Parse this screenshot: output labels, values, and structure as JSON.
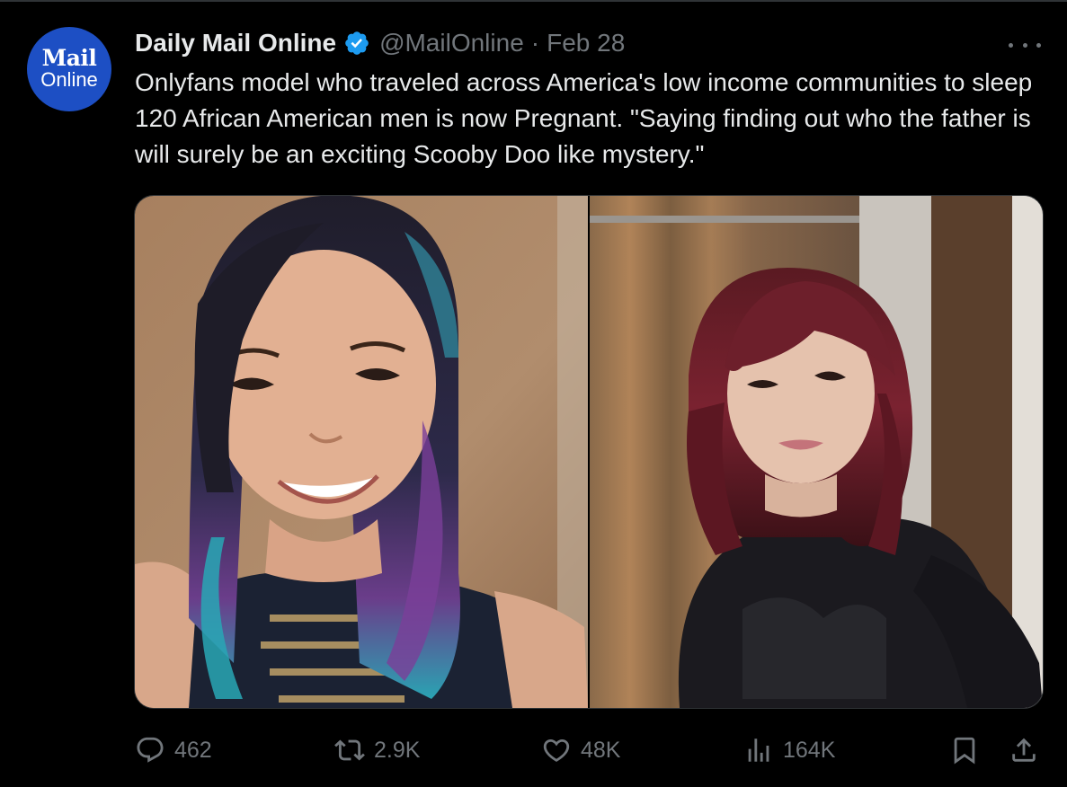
{
  "tweet": {
    "author": {
      "name": "Daily Mail Online",
      "handle": "@MailOnline",
      "separator": "·",
      "date": "Feb 28",
      "avatar_line1": "Mail",
      "avatar_line2": "Online",
      "verified_icon": "verified-badge-icon"
    },
    "text": "Onlyfans model who traveled across America's low income communities to sleep 120 African American men is now Pregnant. \"Saying finding out who the father is will surely be an exciting Scooby Doo like mystery.\"",
    "media": [
      {
        "icon": "photo-left"
      },
      {
        "icon": "photo-right"
      }
    ],
    "actions": {
      "replies": "462",
      "retweets": "2.9K",
      "likes": "48K",
      "views": "164K"
    }
  },
  "colors": {
    "background": "#000000",
    "text": "#e7e9ea",
    "muted": "#71767b",
    "verified": "#1d9bf0",
    "avatar_bg": "#1d4fc4"
  }
}
